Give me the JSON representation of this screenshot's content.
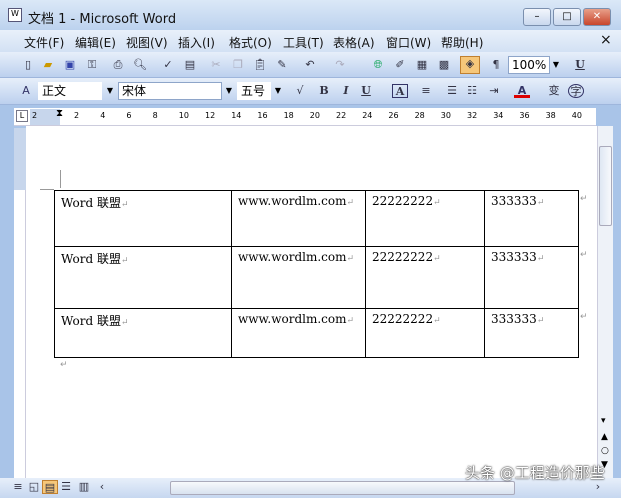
{
  "window": {
    "title": "文档 1 - Microsoft Word",
    "minimize": "–",
    "maximize": "□",
    "close": "✕"
  },
  "menu": [
    "文件(F)",
    "编辑(E)",
    "视图(V)",
    "插入(I)",
    "格式(O)",
    "工具(T)",
    "表格(A)",
    "窗口(W)",
    "帮助(H)"
  ],
  "menu_close": "×",
  "toolbar": {
    "zoom": "100%",
    "underline": "U"
  },
  "format": {
    "style": "正文",
    "font": "宋体",
    "size": "五号",
    "bold": "B",
    "italic": "I",
    "underline": "U",
    "font_color": "A"
  },
  "ruler": [
    "2",
    "2",
    "4",
    "6",
    "8",
    "10",
    "12",
    "14",
    "16",
    "18",
    "20",
    "22",
    "24",
    "26",
    "28",
    "30",
    "32",
    "34",
    "36",
    "38",
    "40"
  ],
  "table": [
    [
      "Word 联盟",
      "www.wordlm.com",
      "22222222",
      "333333"
    ],
    [
      "Word 联盟",
      "www.wordlm.com",
      "22222222",
      "333333"
    ],
    [
      "Word 联盟",
      "www.wordlm.com",
      "22222222",
      "333333"
    ]
  ],
  "watermark": "头条 @工程造价那些"
}
